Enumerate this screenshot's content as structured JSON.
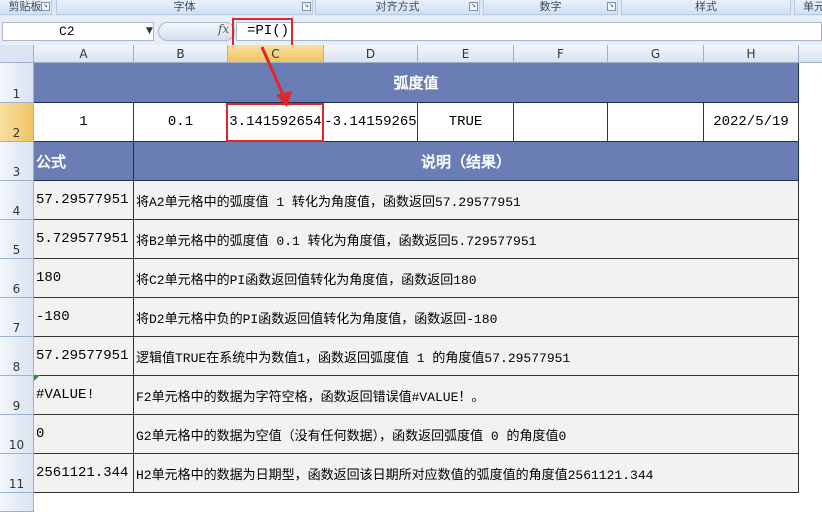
{
  "ribbon": {
    "groups": [
      "剪贴板",
      "字体",
      "对齐方式",
      "数字",
      "样式",
      "单元"
    ]
  },
  "formula_bar": {
    "name_box": "C2",
    "fx_label": "fx",
    "formula": "=PI()"
  },
  "columns": [
    "A",
    "B",
    "C",
    "D",
    "E",
    "F",
    "G",
    "H"
  ],
  "rows": [
    "1",
    "2",
    "3",
    "4",
    "5",
    "6",
    "7",
    "8",
    "9",
    "10",
    "11"
  ],
  "sheet": {
    "title": "弧度值",
    "row2": [
      "1",
      "0.1",
      "3.141592654",
      "-3.14159265",
      "TRUE",
      "",
      "",
      "2022/5/19"
    ],
    "header_formula": "公式",
    "header_desc": "说明（结果）",
    "table": [
      {
        "result": "57.29577951",
        "desc": "将A2单元格中的弧度值 1 转化为角度值，函数返回57.29577951"
      },
      {
        "result": "5.729577951",
        "desc": "将B2单元格中的弧度值 0.1 转化为角度值，函数返回5.729577951"
      },
      {
        "result": "180",
        "desc": "将C2单元格中的PI函数返回值转化为角度值，函数返回180"
      },
      {
        "result": "-180",
        "desc": "将D2单元格中负的PI函数返回值转化为角度值，函数返回-180"
      },
      {
        "result": "57.29577951",
        "desc": "逻辑值TRUE在系统中为数值1，函数返回弧度值 1 的角度值57.29577951"
      },
      {
        "result": "#VALUE!",
        "desc": "F2单元格中的数据为字符空格，函数返回错误值#VALUE！。"
      },
      {
        "result": "0",
        "desc": "G2单元格中的数据为空值（没有任何数据），函数返回弧度值 0 的角度值0"
      },
      {
        "result": "2561121.344",
        "desc": "H2单元格中的数据为日期型，函数返回该日期所对应数值的弧度值的角度值2561121.344"
      }
    ]
  },
  "colors": {
    "header_bg": "#6a7db5",
    "highlight": "#e0262b",
    "selected_header": "#f0c363"
  }
}
